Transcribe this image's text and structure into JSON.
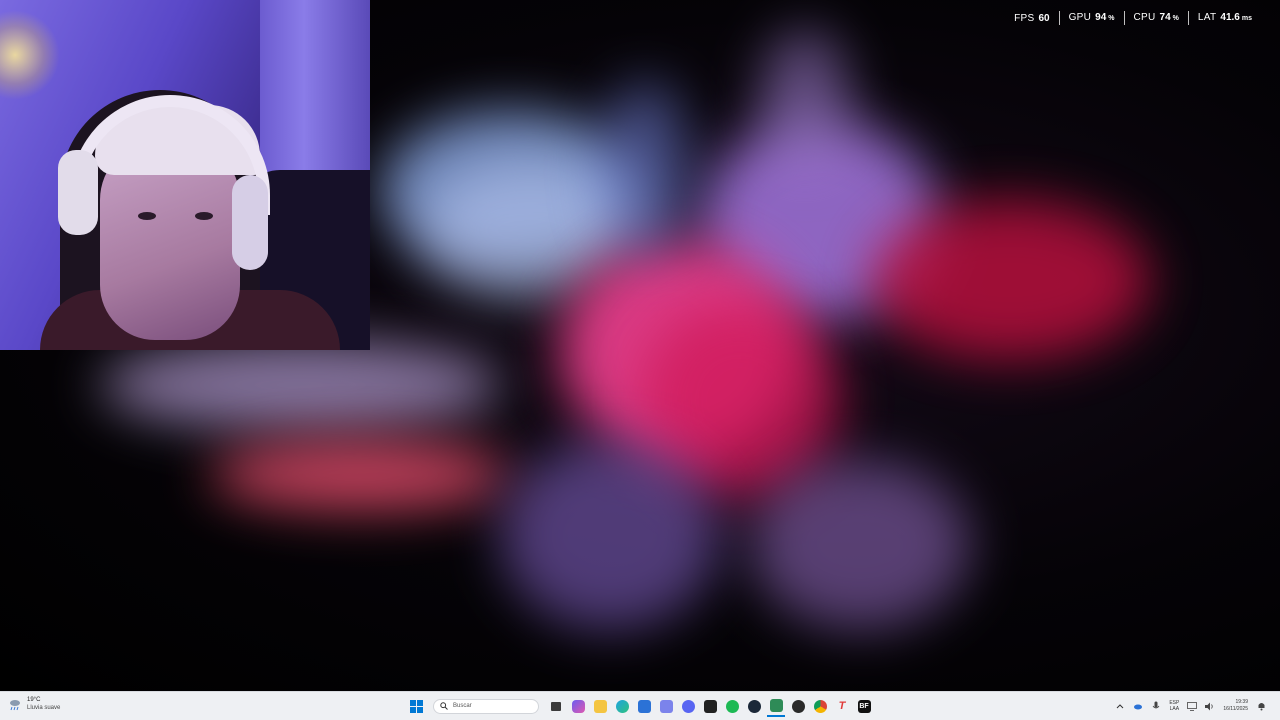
{
  "overlay": {
    "items": [
      {
        "label": "FPS",
        "value": "60",
        "unit": ""
      },
      {
        "label": "GPU",
        "value": "94",
        "unit": "%"
      },
      {
        "label": "CPU",
        "value": "74",
        "unit": "%"
      },
      {
        "label": "LAT",
        "value": "41.6",
        "unit": "ms"
      }
    ]
  },
  "taskbar": {
    "weather": {
      "temp": "19°C",
      "description": "Lluvia suave",
      "icon": "rain-cloud-icon"
    },
    "search_placeholder": "Buscar",
    "apps": [
      {
        "name": "task-view-icon",
        "color": "#3b3b3b"
      },
      {
        "name": "copilot-icon",
        "color": "#6b5cf0"
      },
      {
        "name": "file-explorer-icon",
        "color": "#f4c542"
      },
      {
        "name": "edge-icon",
        "color": "#1fa3e0"
      },
      {
        "name": "microsoft-store-icon",
        "color": "#2b72d6"
      },
      {
        "name": "teams-icon",
        "color": "#7b83eb"
      },
      {
        "name": "discord-icon",
        "color": "#5865f2"
      },
      {
        "name": "epic-games-icon",
        "color": "#222222"
      },
      {
        "name": "spotify-icon",
        "color": "#1db954"
      },
      {
        "name": "steam-icon",
        "color": "#1b2838"
      },
      {
        "name": "app-active-icon",
        "color": "#2e8b57"
      },
      {
        "name": "obs-icon",
        "color": "#2a2a2a"
      },
      {
        "name": "chrome-icon",
        "color": "#db4437"
      },
      {
        "name": "text-editor-icon",
        "color": "#e03a3a"
      },
      {
        "name": "battlefield-icon",
        "color": "#111111"
      }
    ],
    "tray": {
      "language_line1": "ESP",
      "language_line2": "LAA",
      "time": "19:39",
      "date": "16/11/2025"
    }
  }
}
